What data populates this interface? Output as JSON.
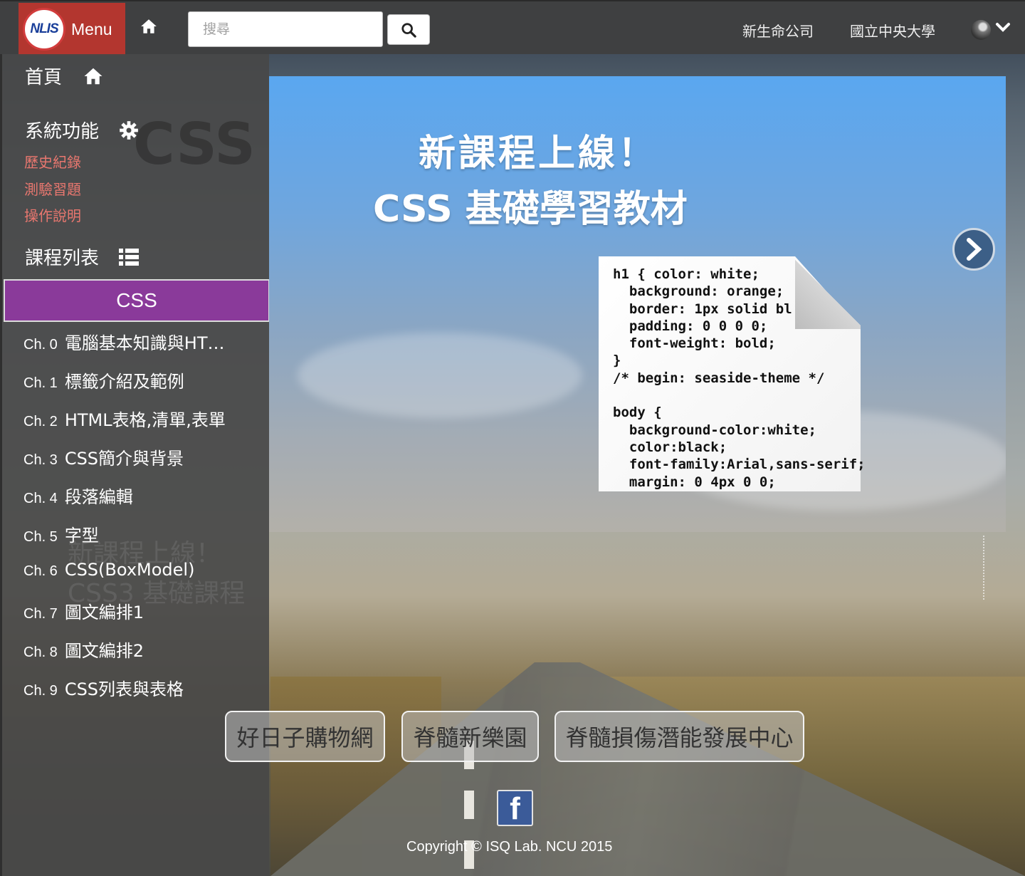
{
  "header": {
    "brand_logo_text": "NLIS",
    "brand_label": "Menu",
    "search_placeholder": "搜尋",
    "links": [
      "新生命公司",
      "國立中央大學"
    ]
  },
  "sidebar": {
    "home_label": "首頁",
    "system_label": "系統功能",
    "system_links": [
      "歷史紀錄",
      "測驗習題",
      "操作說明"
    ],
    "course_list_label": "課程列表",
    "active_course": "CSS",
    "chapters": [
      {
        "num": "Ch. 0",
        "title": "電腦基本知識與HT…"
      },
      {
        "num": "Ch. 1",
        "title": "標籤介紹及範例"
      },
      {
        "num": "Ch. 2",
        "title": "HTML表格,清單,表單"
      },
      {
        "num": "Ch. 3",
        "title": "CSS簡介與背景"
      },
      {
        "num": "Ch. 4",
        "title": "段落編輯"
      },
      {
        "num": "Ch. 5",
        "title": "字型"
      },
      {
        "num": "Ch. 6",
        "title": "CSS(BoxModel)"
      },
      {
        "num": "Ch. 7",
        "title": "圖文編排1"
      },
      {
        "num": "Ch. 8",
        "title": "圖文編排2"
      },
      {
        "num": "Ch. 9",
        "title": "CSS列表與表格"
      }
    ]
  },
  "banner": {
    "title_line1": "新課程上線！",
    "title_line2": "CSS 基礎學習教材",
    "code": "h1 { color: white;\n  background: orange;\n  border: 1px solid bl\n  padding: 0 0 0 0;\n  font-weight: bold;\n}\n/* begin: seaside-theme */\n\nbody {\n  background-color:white;\n  color:black;\n  font-family:Arial,sans-serif;\n  margin: 0 4px 0 0;"
  },
  "ghost_text": {
    "line1": "新課程上線！",
    "line2": "CSS3 基礎課程"
  },
  "footer": {
    "buttons": [
      "好日子購物網",
      "脊髓新樂園",
      "脊髓損傷潛能發展中心"
    ],
    "facebook_glyph": "f",
    "copyright": "Copyright © ISQ Lab. NCU 2015"
  },
  "colors": {
    "brand": "#b3362f",
    "active_course": "#8a3a9a",
    "system_link": "#e8776f",
    "facebook": "#3b5b99"
  }
}
